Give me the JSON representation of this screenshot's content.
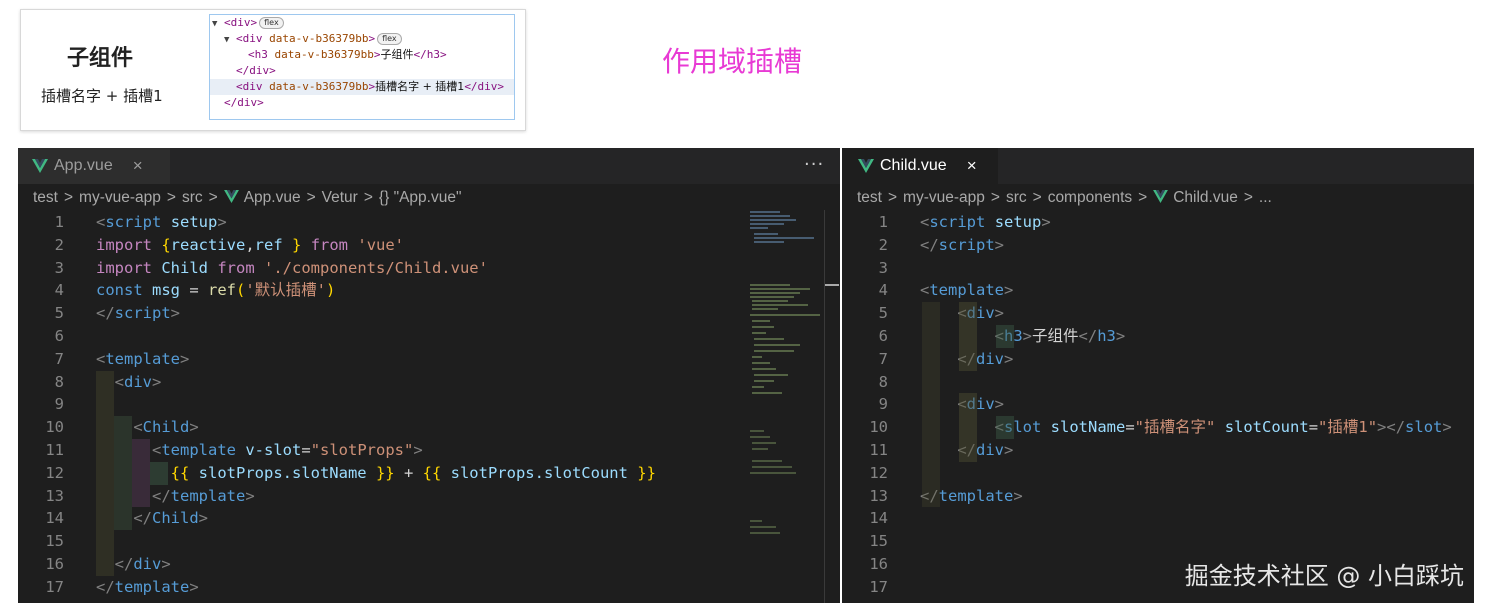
{
  "preview": {
    "heading": "子组件",
    "slot_line": "插槽名字 + 插槽1"
  },
  "devtools": {
    "rows": [
      {
        "indent": 0,
        "arrow": "▼",
        "open": "<div>",
        "attr": "",
        "text": "",
        "close": "",
        "badge": "flex"
      },
      {
        "indent": 1,
        "arrow": "▼",
        "open": "<div ",
        "attr": "data-v-b36379bb",
        "text": "",
        "close": ">",
        "badge": "flex"
      },
      {
        "indent": 2,
        "arrow": "",
        "open": "<h3 ",
        "attr": "data-v-b36379bb",
        "text": "子组件",
        "close": "></h3>",
        "badge": ""
      },
      {
        "indent": 1,
        "arrow": "",
        "open": "</div>",
        "attr": "",
        "text": "",
        "close": "",
        "badge": ""
      },
      {
        "indent": 1,
        "arrow": "",
        "open": "<div ",
        "attr": "data-v-b36379bb",
        "text": "插槽名字 + 插槽1",
        "close": "></div>",
        "badge": ""
      },
      {
        "indent": 0,
        "arrow": "",
        "open": "</div>",
        "attr": "",
        "text": "",
        "close": "",
        "badge": ""
      }
    ]
  },
  "annotation_title": "作用域插槽",
  "left_editor": {
    "tab_label": "App.vue",
    "tab_close": "×",
    "more_actions": "···",
    "breadcrumb": [
      "test",
      "my-vue-app",
      "src",
      "App.vue",
      "Vetur",
      "{} \"App.vue\""
    ],
    "line_numbers": [
      "1",
      "2",
      "3",
      "4",
      "5",
      "6",
      "7",
      "8",
      "9",
      "10",
      "11",
      "12",
      "13",
      "14",
      "15",
      "16",
      "17"
    ]
  },
  "right_editor": {
    "tab_label": "Child.vue",
    "tab_close": "×",
    "breadcrumb": [
      "test",
      "my-vue-app",
      "src",
      "components",
      "Child.vue",
      "..."
    ],
    "line_numbers": [
      "1",
      "2",
      "3",
      "4",
      "5",
      "6",
      "7",
      "8",
      "9",
      "10",
      "11",
      "12",
      "13",
      "14",
      "15",
      "16",
      "17"
    ]
  },
  "watermark": "掘金技术社区 @ 小白踩坑",
  "colors": {
    "editor_bg": "#1e1e1e",
    "tag": "#569cd6",
    "keyword": "#c586c0",
    "variable": "#9cdcfe",
    "string": "#ce9178",
    "function": "#dcdcaa",
    "title_pink": "#e83ad4",
    "vue_green": "#41b883"
  }
}
